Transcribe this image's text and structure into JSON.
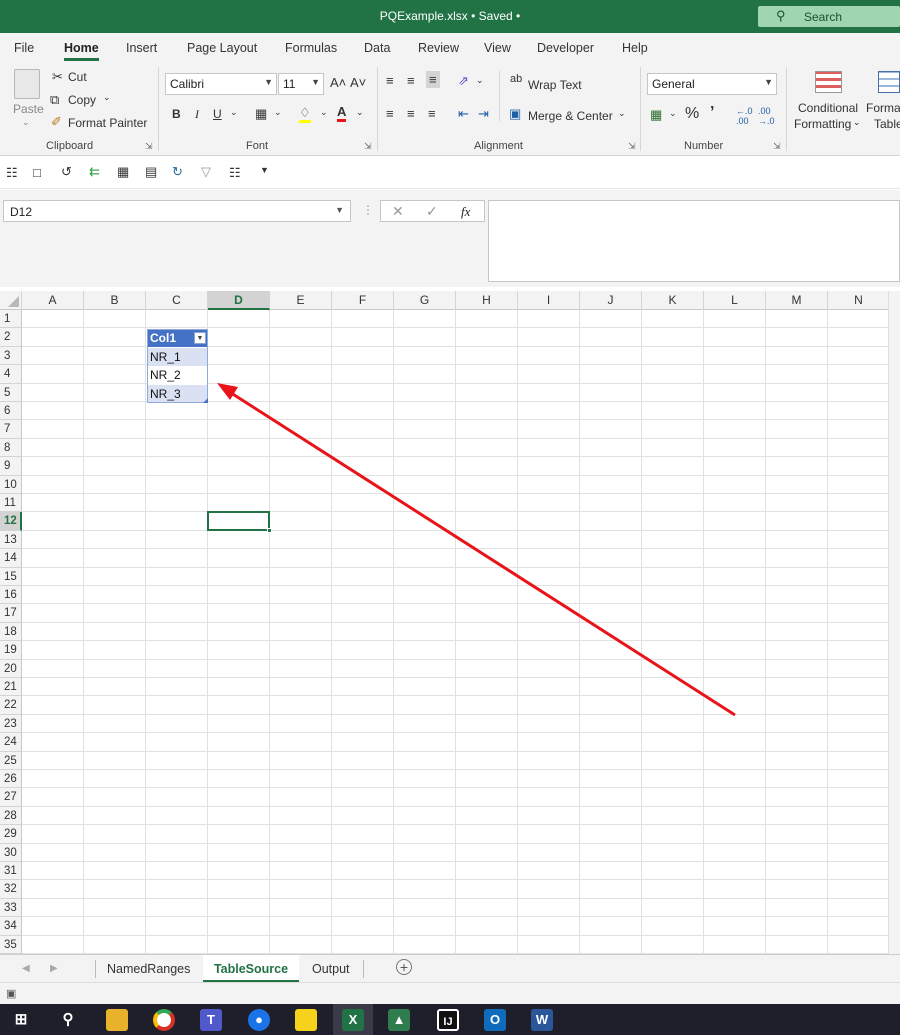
{
  "window": {
    "title": "PQExample.xlsx  •  Saved  •",
    "search_label": "Search"
  },
  "ribbon_tabs": [
    "File",
    "Home",
    "Insert",
    "Page Layout",
    "Formulas",
    "Data",
    "Review",
    "View",
    "Developer",
    "Help"
  ],
  "clipboard": {
    "paste": "Paste",
    "cut": "Cut",
    "copy": "Copy",
    "format_painter": "Format Painter",
    "group": "Clipboard"
  },
  "font": {
    "name": "Calibri",
    "size": "11",
    "grow": "A˄",
    "shrink": "A˅",
    "bold": "B",
    "italic": "I",
    "underline": "U",
    "group": "Font"
  },
  "alignment": {
    "wrap_text": "Wrap Text",
    "merge_center": "Merge & Center",
    "group": "Alignment"
  },
  "number": {
    "format": "General",
    "percent": "%",
    "comma": "’",
    "group": "Number"
  },
  "styles": {
    "conditional_1": "Conditional",
    "conditional_2": "Formatting",
    "format_1": "Forma",
    "format_2": "Table"
  },
  "formula_bar": {
    "name_box": "D12",
    "formula": "",
    "fx": "fx"
  },
  "columns": [
    "A",
    "B",
    "C",
    "D",
    "E",
    "F",
    "G",
    "H",
    "I",
    "J",
    "K",
    "L",
    "M",
    "N"
  ],
  "rows": [
    "1",
    "2",
    "3",
    "4",
    "5",
    "6",
    "7",
    "8",
    "9",
    "10",
    "11",
    "12",
    "13",
    "14",
    "15",
    "16",
    "17",
    "18",
    "19",
    "20",
    "21",
    "22",
    "23",
    "24",
    "25",
    "26",
    "27",
    "28",
    "29",
    "30",
    "31",
    "32",
    "33",
    "34",
    "35"
  ],
  "table": {
    "header": "Col1",
    "values": [
      "NR_1",
      "NR_2",
      "NR_3"
    ]
  },
  "active_cell": "D12",
  "sheet_tabs": [
    "NamedRanges",
    "TableSource",
    "Output"
  ],
  "active_sheet": "TableSource",
  "colors": {
    "excel_green": "#217346",
    "table_header": "#4472c4",
    "table_band": "#d9e1f2",
    "arrow": "#e8141a"
  }
}
